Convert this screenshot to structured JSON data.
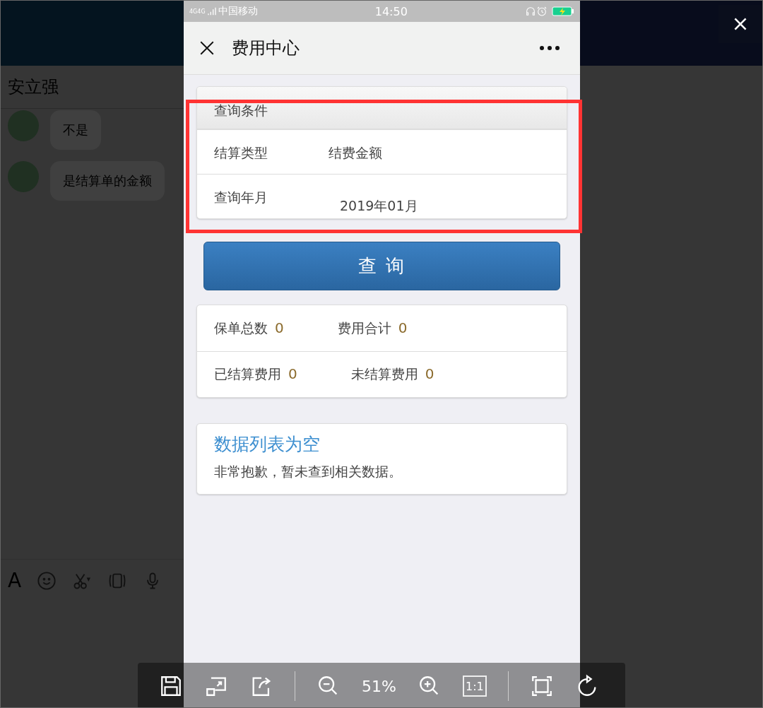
{
  "chat": {
    "contact": "安立强",
    "messages": [
      {
        "text": "不是"
      },
      {
        "text": "是结算单的金额"
      }
    ],
    "format_label": "A"
  },
  "phone": {
    "status_bar": {
      "network_labels": [
        "4G",
        "4G"
      ],
      "carrier": "中国移动",
      "time": "14:50"
    },
    "title": "费用中心",
    "query_card": {
      "header": "查询条件",
      "fields": [
        {
          "label": "结算类型",
          "value": "结费金额"
        },
        {
          "label": "查询年月",
          "value": "2019年01月"
        }
      ]
    },
    "query_button": "查 询",
    "stats": [
      [
        {
          "label": "保单总数",
          "value": "0"
        },
        {
          "label": "费用合计",
          "value": "0"
        }
      ],
      [
        {
          "label": "已结算费用",
          "value": "0"
        },
        {
          "label": "未结算费用",
          "value": "0"
        }
      ]
    ],
    "empty": {
      "title": "数据列表为空",
      "message": "非常抱歉，暂未查到相关数据。"
    }
  },
  "viewer": {
    "zoom_level": "51%",
    "actual_size_label": "1:1"
  }
}
